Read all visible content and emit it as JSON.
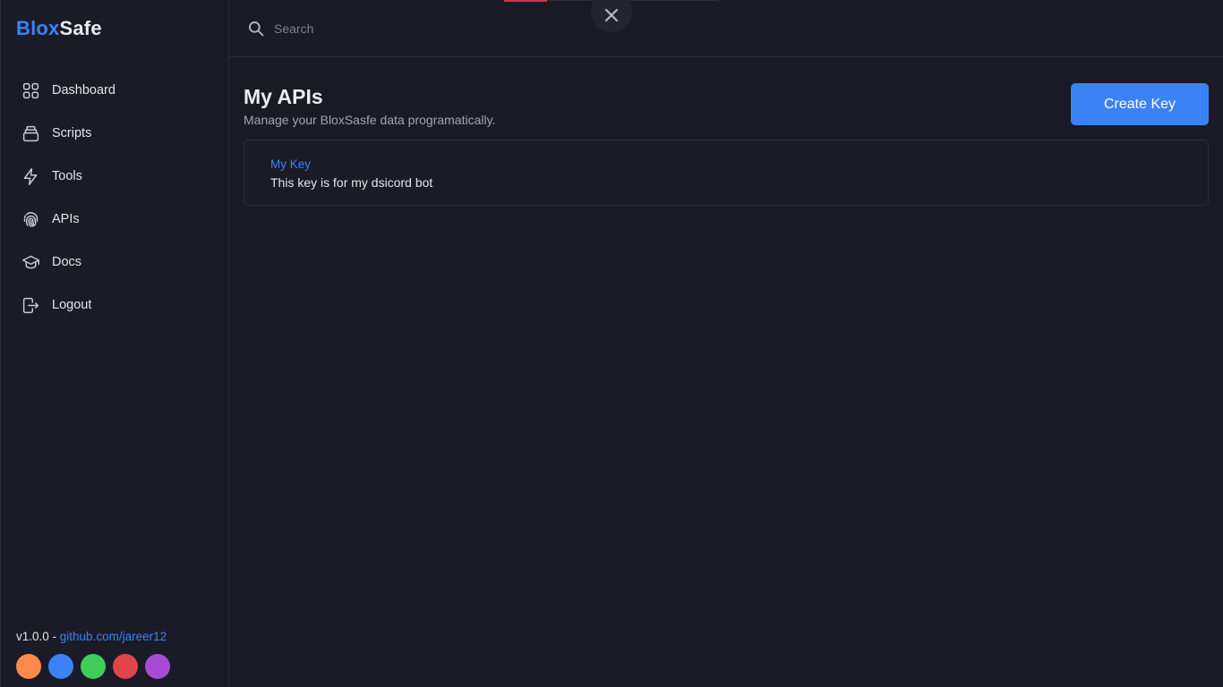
{
  "brand": {
    "part1": "Blox",
    "part2": "Safe"
  },
  "sidebar": {
    "items": [
      {
        "label": "Dashboard",
        "icon": "grid-icon"
      },
      {
        "label": "Scripts",
        "icon": "stack-icon"
      },
      {
        "label": "Tools",
        "icon": "lightning-icon"
      },
      {
        "label": "APIs",
        "icon": "fingerprint-icon"
      },
      {
        "label": "Docs",
        "icon": "graduation-cap-icon"
      },
      {
        "label": "Logout",
        "icon": "logout-icon"
      }
    ],
    "version": "v1.0.0",
    "separator": " - ",
    "repo_link": "github.com/jareer12",
    "theme_colors": [
      "#ff8a4c",
      "#3b82f6",
      "#3fcc5a",
      "#e0454a",
      "#a74bd6"
    ]
  },
  "topbar": {
    "search_placeholder": "Search",
    "close_icon": "close-icon"
  },
  "main": {
    "title": "My APIs",
    "subtitle": "Manage your BloxSasfe data programatically.",
    "create_button": "Create Key",
    "keys": [
      {
        "name": "My Key",
        "description": "This key is for my dsicord bot"
      }
    ]
  },
  "colors": {
    "accent": "#3b82f6",
    "background": "#1a1a27"
  }
}
